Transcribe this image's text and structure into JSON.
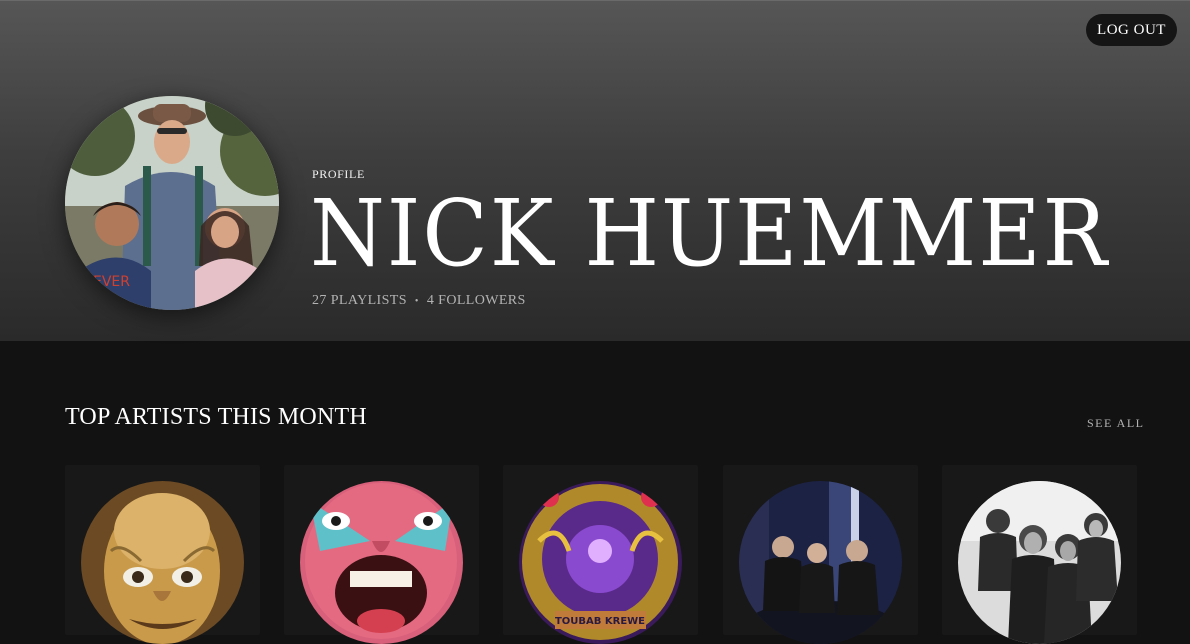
{
  "header": {
    "logout_label": "LOG OUT",
    "profile_label": "PROFILE",
    "user_name": "NICK HUEMMER",
    "playlists": "27 PLAYLISTS",
    "separator": "•",
    "followers": "4 FOLLOWERS"
  },
  "top_artists": {
    "title": "TOP ARTISTS THIS MONTH",
    "see_all": "SEE ALL",
    "cards": [
      {
        "icon": "gentle-giant-face-artwork"
      },
      {
        "icon": "crimson-king-face-artwork"
      },
      {
        "icon": "psychedelic-album-artwork"
      },
      {
        "icon": "band-photo-color"
      },
      {
        "icon": "band-photo-monochrome"
      }
    ],
    "artwork_text": "TOUBAB KREWE"
  },
  "colors": {
    "background": "#121212",
    "card": "#181818",
    "muted_text": "#b3b3b3"
  }
}
